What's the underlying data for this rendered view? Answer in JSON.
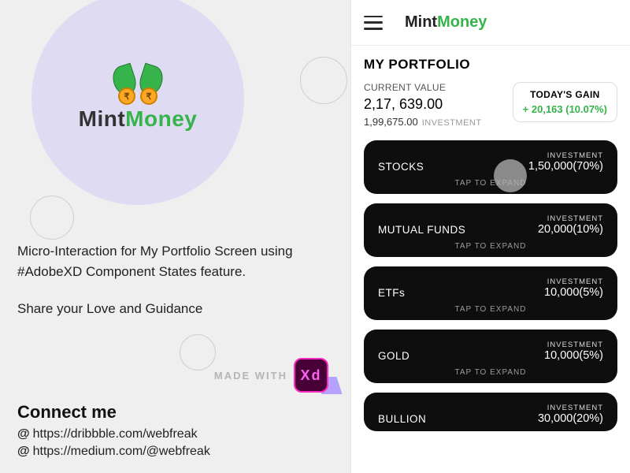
{
  "brand": {
    "part1": "Mint",
    "part2": "Money",
    "coin_glyph": "₹"
  },
  "left": {
    "description_line1": "Micro-Interaction for My Portfolio Screen using #AdobeXD Component States feature.",
    "description_line2": "Share your Love and Guidance",
    "made_with_label": "MADE WITH",
    "xd_label": "Xd",
    "connect_title": "Connect me",
    "links": [
      "https://dribbble.com/webfreak",
      "https://medium.com/@webfreak"
    ],
    "at_glyph": "@"
  },
  "app": {
    "section_title": "MY PORTFOLIO",
    "current_value_label": "CURRENT VALUE",
    "current_value": "2,17, 639.00",
    "investment_value": "1,99,675.00",
    "investment_label": "INVESTMENT",
    "gain": {
      "title": "TODAY'S GAIN",
      "value": "+ 20,163 (10.07%)"
    },
    "tap_label": "TAP TO EXPAND",
    "asset_inv_label": "INVESTMENT",
    "assets": [
      {
        "name": "STOCKS",
        "amount": "1,50,000(70%)"
      },
      {
        "name": "MUTUAL FUNDS",
        "amount": "20,000(10%)"
      },
      {
        "name": "ETFs",
        "amount": "10,000(5%)"
      },
      {
        "name": "GOLD",
        "amount": "10,000(5%)"
      },
      {
        "name": "BULLION",
        "amount": "30,000(20%)"
      }
    ]
  }
}
